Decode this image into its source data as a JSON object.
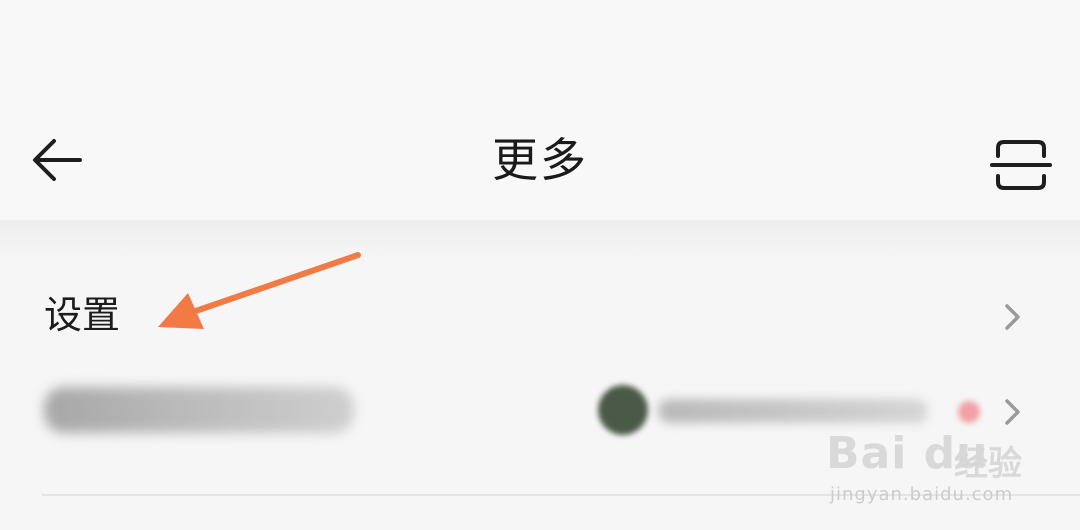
{
  "header": {
    "title": "更多",
    "back_icon": "arrow-left-icon",
    "scan_icon": "scan-icon"
  },
  "menu": {
    "items": [
      {
        "label": "设置",
        "icon": "chevron-right-icon"
      },
      {
        "label": "",
        "icon": "chevron-right-icon"
      }
    ]
  },
  "annotation": {
    "color": "#f27a45"
  },
  "watermark": {
    "logo_text": "Bai du",
    "product": "经验",
    "url": "jingyan.baidu.com"
  }
}
